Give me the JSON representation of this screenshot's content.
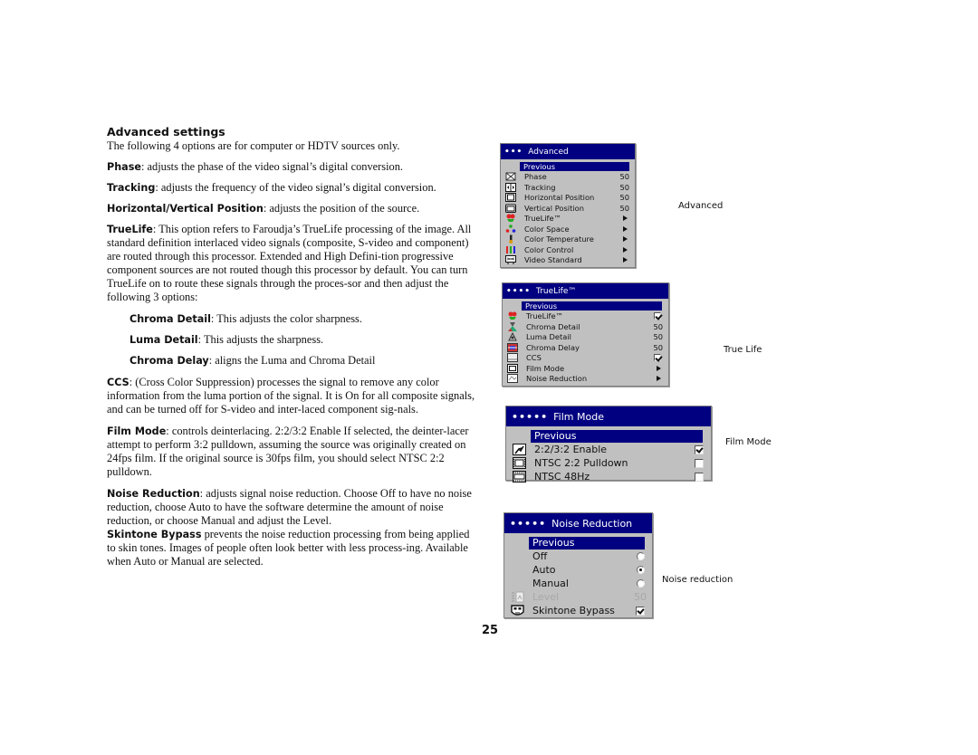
{
  "heading": "Advanced settings",
  "intro": "The following 4 options are for computer or HDTV sources only.",
  "paragraphs": {
    "phase": {
      "term": "Phase",
      "text": ": adjusts the phase of the video signal’s digital conversion."
    },
    "tracking": {
      "term": "Tracking",
      "text": ": adjusts the frequency of the video signal’s digital conversion."
    },
    "position": {
      "term": "Horizontal/Vertical Position",
      "text": ": adjusts the position of the source."
    },
    "truelife": {
      "term": "TrueLife",
      "text": ": This option refers to Faroudja’s TrueLife processing of the image. All standard definition interlaced video signals (composite, S-video and component) are routed through this processor.  Extended and High Defini-tion progressive component sources are not routed though this processor by default.  You can turn TrueLife on to route these signals through the proces-sor and then adjust the following 3 options:"
    },
    "chroma_detail": {
      "term": "Chroma Detail",
      "text": ": This adjusts the color sharpness."
    },
    "luma_detail": {
      "term": "Luma Detail",
      "text": ": This adjusts the sharpness."
    },
    "chroma_delay": {
      "term": "Chroma Delay",
      "text": ": aligns the Luma and Chroma Detail"
    },
    "ccs": {
      "term": "CCS",
      "text": ": (Cross Color Suppression) processes the signal to remove any color information from the luma portion of the signal. It is On for all composite signals, and can be turned off for S-video and inter-laced component sig-nals."
    },
    "film_mode": {
      "term": "Film Mode",
      "text": ": controls deinterlacing. 2:2/3:2 Enable If selected, the deinter-lacer attempt to perform 3:2 pulldown, assuming the source was originally created on 24fps film.  If the original source is 30fps film, you should select NTSC 2:2 pulldown."
    },
    "noise_reduction": {
      "term": "Noise Reduction",
      "text": ": adjusts signal noise reduction. Choose Off to have no noise reduction, choose Auto to have the software determine the amount of noise reduction, or choose Manual and adjust the Level."
    },
    "skintone": {
      "term": "Skintone Bypass",
      "text": " prevents the noise reduction processing from being applied to skin tones. Images of people often look better with less process-ing. Available when Auto or Manual are selected."
    }
  },
  "menus": {
    "advanced": {
      "dots": "•••",
      "title": "Advanced",
      "previous": "Previous",
      "caption": "Advanced",
      "items": [
        {
          "icon": "phase-icon",
          "label": "Phase",
          "value": "50"
        },
        {
          "icon": "tracking-icon",
          "label": "Tracking",
          "value": "50"
        },
        {
          "icon": "horizontal-position-icon",
          "label": "Horizontal Position",
          "value": "50"
        },
        {
          "icon": "vertical-position-icon",
          "label": "Vertical Position",
          "value": "50"
        },
        {
          "icon": "truelife-icon",
          "label": "TrueLife™",
          "value": "submenu"
        },
        {
          "icon": "color-space-icon",
          "label": "Color Space",
          "value": "submenu"
        },
        {
          "icon": "color-temperature-icon",
          "label": "Color Temperature",
          "value": "submenu"
        },
        {
          "icon": "color-control-icon",
          "label": "Color Control",
          "value": "submenu"
        },
        {
          "icon": "video-standard-icon",
          "label": "Video Standard",
          "value": "submenu"
        }
      ]
    },
    "truelife": {
      "dots": "••••",
      "title": "TrueLife™",
      "previous": "Previous",
      "caption": "True Life",
      "items": [
        {
          "icon": "truelife-icon",
          "label": "TrueLife™",
          "value": "checked"
        },
        {
          "icon": "chroma-detail-icon",
          "label": "Chroma Detail",
          "value": "50"
        },
        {
          "icon": "luma-detail-icon",
          "label": "Luma Detail",
          "value": "50"
        },
        {
          "icon": "chroma-delay-icon",
          "label": "Chroma Delay",
          "value": "50"
        },
        {
          "icon": "ccs-icon",
          "label": "CCS",
          "value": "checked"
        },
        {
          "icon": "film-mode-icon",
          "label": "Film Mode",
          "value": "submenu"
        },
        {
          "icon": "noise-reduction-icon",
          "label": "Noise Reduction",
          "value": "submenu"
        }
      ]
    },
    "film_mode": {
      "dots": "•••••",
      "title": "Film Mode",
      "previous": "Previous",
      "caption": "Film Mode",
      "items": [
        {
          "icon": "pulldown-enable-icon",
          "label": "2:2/3:2 Enable",
          "value": "checked"
        },
        {
          "icon": "ntsc-pulldown-icon",
          "label": "NTSC 2:2 Pulldown",
          "value": "unchecked"
        },
        {
          "icon": "ntsc-48hz-icon",
          "label": "NTSC 48Hz",
          "value": "unchecked"
        }
      ]
    },
    "noise_reduction": {
      "dots": "•••••",
      "title": "Noise Reduction",
      "previous": "Previous",
      "caption": "Noise reduction",
      "items": [
        {
          "icon": "",
          "label": "Off",
          "value": "radio-off"
        },
        {
          "icon": "",
          "label": "Auto",
          "value": "radio-on"
        },
        {
          "icon": "",
          "label": "Manual",
          "value": "radio-off"
        },
        {
          "icon": "level-icon",
          "label": "Level",
          "value": "50",
          "disabled": true
        },
        {
          "icon": "skintone-bypass-icon",
          "label": "Skintone Bypass",
          "value": "checked"
        }
      ]
    }
  },
  "colors": {
    "menu_title_bg": "#000080",
    "menu_bg": "#c0c0c0",
    "highlight_bg": "#000080"
  },
  "page_number": "25"
}
